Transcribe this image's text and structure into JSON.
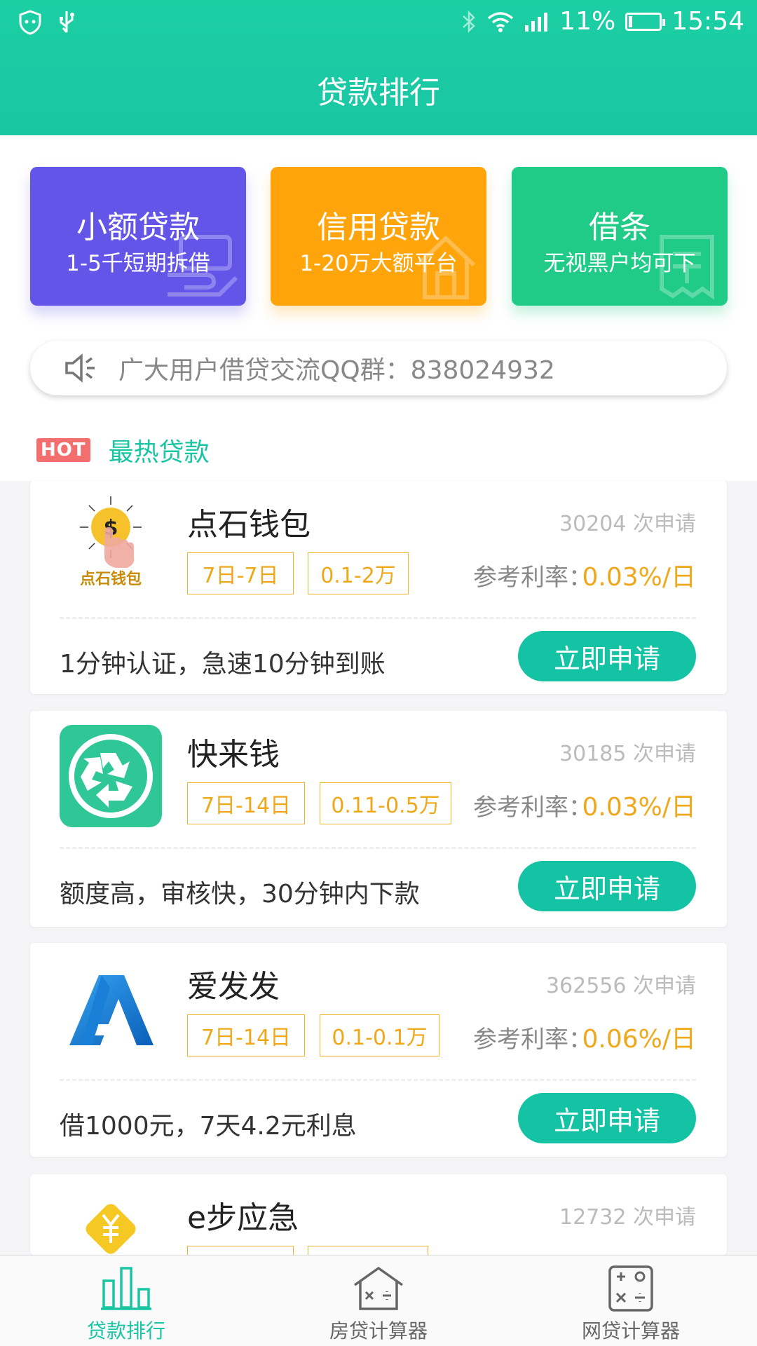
{
  "status": {
    "battery": "11%",
    "time": "15:54",
    "battery_fill": 0.11
  },
  "header": {
    "title": "贷款排行"
  },
  "categories": [
    {
      "title": "小额贷款",
      "subtitle": "1-5千短期拆借",
      "color": "#6355e8"
    },
    {
      "title": "信用贷款",
      "subtitle": "1-20万大额平台",
      "color": "#ffa40b"
    },
    {
      "title": "借条",
      "subtitle": "无视黑户均可下",
      "color": "#1fcb86"
    }
  ],
  "notice": {
    "text": "广大用户借贷交流QQ群：838024932"
  },
  "hot": {
    "badge": "HOT",
    "title": "最热贷款"
  },
  "loans": [
    {
      "name": "点石钱包",
      "count": "30204 次申请",
      "tags": [
        "7日-7日",
        "0.1-2万"
      ],
      "rate_label": "参考利率：",
      "rate": "0.03%/日",
      "desc": "1分钟认证，急速10分钟到账",
      "apply": "立即申请",
      "logo_text": "点石钱包",
      "logo_icon": "dollar-coin-hand-icon"
    },
    {
      "name": "快来钱",
      "count": "30185 次申请",
      "tags": [
        "7日-14日",
        "0.11-0.5万"
      ],
      "rate_label": "参考利率：",
      "rate": "0.03%/日",
      "desc": "额度高，审核快，30分钟内下款",
      "apply": "立即申请",
      "logo_icon": "recycle-icon"
    },
    {
      "name": "爱发发",
      "count": "362556 次申请",
      "tags": [
        "7日-14日",
        "0.1-0.1万"
      ],
      "rate_label": "参考利率：",
      "rate": "0.06%/日",
      "desc": "借1000元，7天4.2元利息",
      "apply": "立即申请",
      "logo_icon": "aff-logo-icon"
    },
    {
      "name": "e步应急",
      "count": "12732 次申请",
      "tags": [
        "",
        ""
      ],
      "logo_icon": "yen-diamond-icon"
    }
  ],
  "bottom_nav": [
    {
      "label": "贷款排行",
      "active": true,
      "icon": "bar-chart-icon"
    },
    {
      "label": "房贷计算器",
      "active": false,
      "icon": "house-calculator-icon"
    },
    {
      "label": "网贷计算器",
      "active": false,
      "icon": "calculator-icon"
    }
  ],
  "colors": {
    "accent": "#19c6a4",
    "tag": "#f0a81b",
    "hot": "#f36e6e"
  }
}
